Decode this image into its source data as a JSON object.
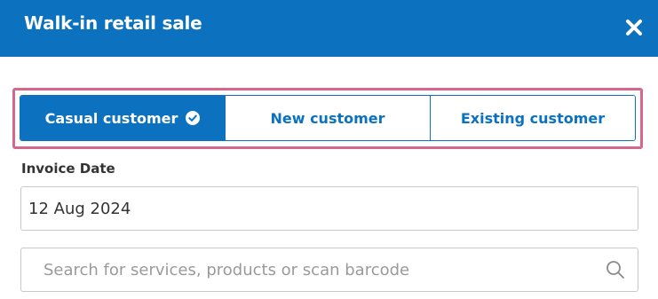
{
  "header": {
    "title": "Walk-in retail sale",
    "close_icon": "close-icon",
    "background_color": "#0c72bf"
  },
  "customer_type": {
    "options": [
      {
        "label": "Casual customer",
        "selected": true,
        "icon": "check-circle-icon"
      },
      {
        "label": "New customer",
        "selected": false
      },
      {
        "label": "Existing customer",
        "selected": false
      }
    ],
    "highlight_color": "#d5688a"
  },
  "invoice_date": {
    "label": "Invoice Date",
    "value": "12 Aug 2024"
  },
  "search": {
    "placeholder": "Search for services, products or scan barcode",
    "value": "",
    "icon": "search-icon"
  }
}
